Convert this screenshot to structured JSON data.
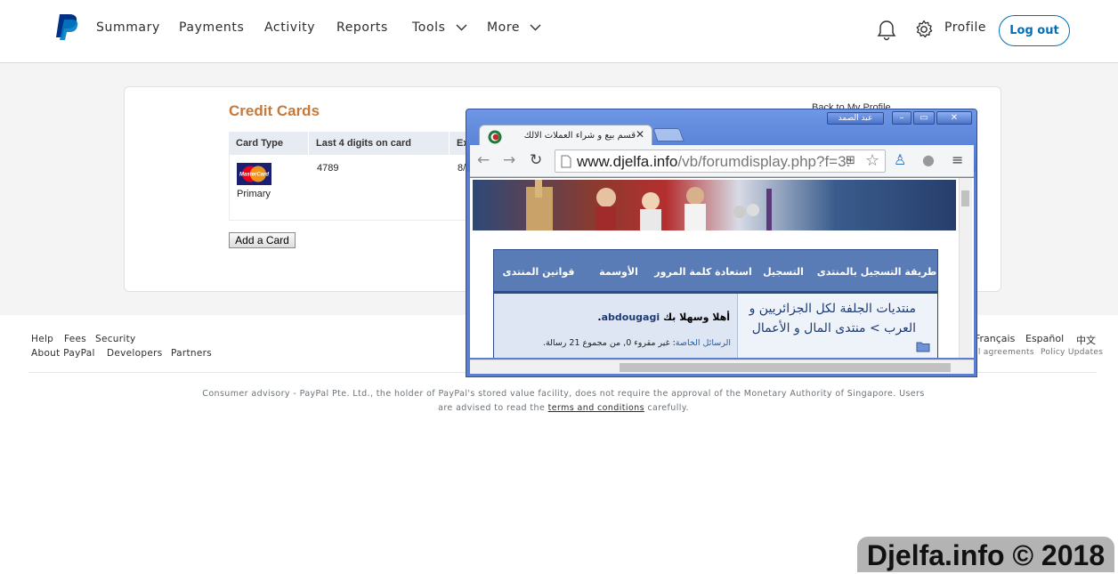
{
  "header": {
    "nav": [
      "Summary",
      "Payments",
      "Activity",
      "Reports",
      "Tools",
      "More"
    ],
    "profile_label": "Profile",
    "logout_label": "Log out",
    "icons": [
      "paypal-logo",
      "chevron-down-icon",
      "bell-icon",
      "gear-icon"
    ]
  },
  "credit_cards": {
    "title": "Credit Cards",
    "back_link": "Back to My Profile",
    "columns": [
      "Card Type",
      "Last 4 digits on card",
      "Ex"
    ],
    "card": {
      "brand_logo_text": "MasterCard",
      "status": "Primary",
      "last4": "4789",
      "expiry_fragment": "8/"
    },
    "add_card_label": "Add a Card"
  },
  "footer": {
    "links_row1": [
      "Help",
      "Fees",
      "Security"
    ],
    "links_row2": [
      "About PayPal",
      "Developers",
      "Partners"
    ],
    "languages": [
      "Français",
      "Español",
      "中文"
    ],
    "legal_links": [
      "al agreements",
      "Policy Updates"
    ],
    "advisory_pre": "Consumer advisory - PayPal Pte. Ltd., the holder of PayPal's stored value facility, does not require the approval of the Monetary Authority of Singapore. Users are advised to read the ",
    "advisory_link": "terms and conditions",
    "advisory_post": " carefully."
  },
  "overlay_browser": {
    "user_tag": "عبد الصمد",
    "window_buttons": [
      "minimize",
      "maximize",
      "close"
    ],
    "tab_title": "قسم بيع و شراء العملات الالك",
    "url_main": "www.djelfa.info",
    "url_path": "/vb/forumdisplay.php?f=3:",
    "forum_nav": [
      "طريقة التسجيل بالمنتدى",
      "التسجيل",
      "استعادة كلمة المرور",
      "الأوسمة",
      "قوانين المنتدى"
    ],
    "breadcrumb": "منتديات الجلفة لكل الجزائريين و العرب > منتدى المال و الأعمال",
    "welcome_prefix": "أهلا وسهلا بك ",
    "username": "abdougagi",
    "welcome_suffix": ".",
    "pm_label": "الرسائل الخاصة",
    "pm_text": ": غير مقروء 0, من مجموع 21 رسالة."
  },
  "watermark": "Djelfa.info © 2018",
  "colors": {
    "paypal_blue": "#0070ba",
    "cc_title_orange": "#c5793a",
    "window_frame_blue": "#5a7fd0",
    "forum_nav_blue": "#5a7cb6"
  }
}
